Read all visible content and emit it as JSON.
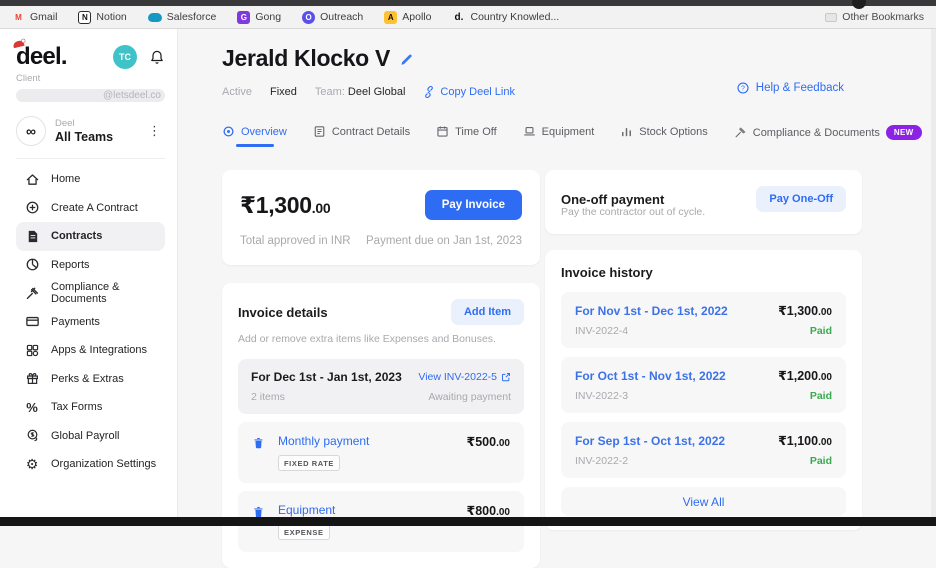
{
  "browser": {
    "bookmarks": [
      {
        "label": "Gmail"
      },
      {
        "label": "Notion"
      },
      {
        "label": "Salesforce"
      },
      {
        "label": "Gong"
      },
      {
        "label": "Outreach"
      },
      {
        "label": "Apollo"
      },
      {
        "label": "Country Knowled..."
      }
    ],
    "other_bookmarks": "Other Bookmarks"
  },
  "icons": {
    "infinity": "∞",
    "kebab": "⋮",
    "percent": "%",
    "gear": "⚙"
  },
  "sidebar": {
    "logo": "deel.",
    "client_label": "Client",
    "email_domain": "@letsdeel.co",
    "avatar_initials": "TC",
    "team_org": "Deel",
    "team_name": "All Teams",
    "items": [
      {
        "label": "Home"
      },
      {
        "label": "Create A Contract"
      },
      {
        "label": "Contracts"
      },
      {
        "label": "Reports"
      },
      {
        "label": "Compliance & Documents"
      },
      {
        "label": "Payments"
      },
      {
        "label": "Apps & Integrations"
      },
      {
        "label": "Perks & Extras"
      },
      {
        "label": "Tax Forms"
      },
      {
        "label": "Global Payroll"
      },
      {
        "label": "Organization Settings"
      }
    ]
  },
  "header": {
    "name": "Jerald Klocko V",
    "status": "Active",
    "rate_type": "Fixed",
    "team_label": "Team:",
    "team_value": "Deel Global",
    "copy_link": "Copy Deel Link",
    "help": "Help & Feedback"
  },
  "tabs": [
    {
      "label": "Overview"
    },
    {
      "label": "Contract Details"
    },
    {
      "label": "Time Off"
    },
    {
      "label": "Equipment"
    },
    {
      "label": "Stock Options"
    },
    {
      "label": "Compliance & Documents",
      "badge": "NEW"
    }
  ],
  "payment_card": {
    "amount_main": "₹1,300",
    "amount_cents": ".00",
    "subtitle": "Total approved in INR",
    "pay_button": "Pay Invoice",
    "due": "Payment due on Jan 1st, 2023"
  },
  "invoice_details": {
    "title": "Invoice details",
    "add_button": "Add Item",
    "description": "Add or remove extra items like Expenses and Bonuses.",
    "period": {
      "title": "For Dec 1st - Jan 1st, 2023",
      "items_count": "2 items",
      "view_link": "View INV-2022-5",
      "status": "Awaiting payment"
    },
    "line_items": [
      {
        "name": "Monthly payment",
        "badge": "FIXED RATE",
        "amount": "₹500",
        "cents": ".00"
      },
      {
        "name": "Equipment",
        "badge": "EXPENSE",
        "amount": "₹800",
        "cents": ".00"
      }
    ]
  },
  "one_off": {
    "title": "One-off payment",
    "description": "Pay the contractor out of cycle.",
    "button": "Pay One-Off"
  },
  "invoice_history": {
    "title": "Invoice history",
    "rows": [
      {
        "period": "For Nov 1st - Dec 1st, 2022",
        "invoice": "INV-2022-4",
        "amount": "₹1,300",
        "cents": ".00",
        "status": "Paid"
      },
      {
        "period": "For Oct 1st - Nov 1st, 2022",
        "invoice": "INV-2022-3",
        "amount": "₹1,200",
        "cents": ".00",
        "status": "Paid"
      },
      {
        "period": "For Sep 1st - Oct 1st, 2022",
        "invoice": "INV-2022-2",
        "amount": "₹1,100",
        "cents": ".00",
        "status": "Paid"
      }
    ],
    "view_all": "View All"
  },
  "colors": {
    "accent_blue": "#2e6cf3",
    "soft_blue_bg": "#eaf1fd",
    "new_badge_purple": "#8b22e4",
    "paid_green": "#3aa94e",
    "avatar_teal": "#3fc3c8"
  }
}
